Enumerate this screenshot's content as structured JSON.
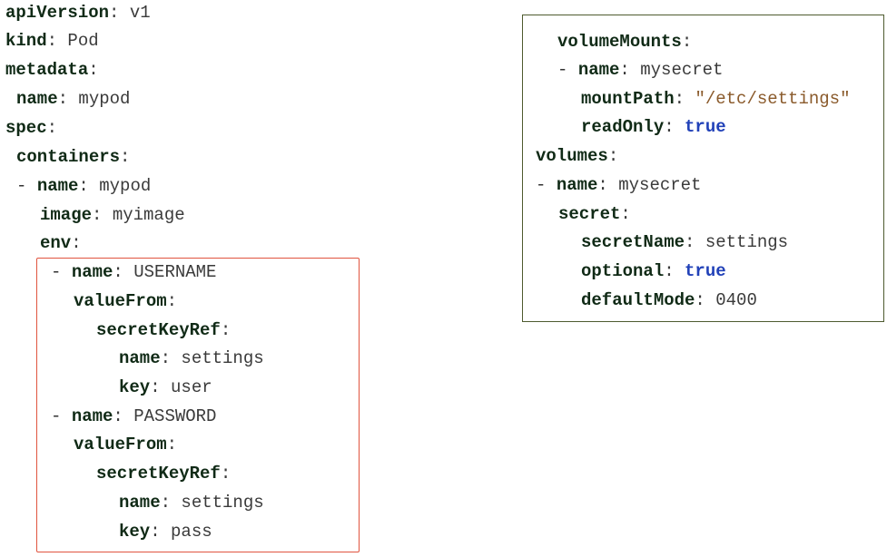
{
  "left": {
    "apiVersion": {
      "key": "apiVersion",
      "value": "v1"
    },
    "kind": {
      "key": "kind",
      "value": "Pod"
    },
    "metadata": {
      "key": "metadata"
    },
    "metadata_name": {
      "key": "name",
      "value": "mypod"
    },
    "spec": {
      "key": "spec"
    },
    "containers": {
      "key": "containers"
    },
    "container_name": {
      "key": "name",
      "value": "mypod"
    },
    "image": {
      "key": "image",
      "value": "myimage"
    },
    "env": {
      "key": "env"
    },
    "env_items": [
      {
        "name_key": "name",
        "name_value": "USERNAME",
        "valueFrom": "valueFrom",
        "secretKeyRef": "secretKeyRef",
        "ref_name_key": "name",
        "ref_name_value": "settings",
        "ref_key_key": "key",
        "ref_key_value": "user"
      },
      {
        "name_key": "name",
        "name_value": "PASSWORD",
        "valueFrom": "valueFrom",
        "secretKeyRef": "secretKeyRef",
        "ref_name_key": "name",
        "ref_name_value": "settings",
        "ref_key_key": "key",
        "ref_key_value": "pass"
      }
    ]
  },
  "right": {
    "volumeMounts": {
      "key": "volumeMounts"
    },
    "mount_name": {
      "key": "name",
      "value": "mysecret"
    },
    "mountPath": {
      "key": "mountPath",
      "value": "\"/etc/settings\""
    },
    "readOnly": {
      "key": "readOnly",
      "value": "true"
    },
    "volumes": {
      "key": "volumes"
    },
    "volume_name": {
      "key": "name",
      "value": "mysecret"
    },
    "secret": {
      "key": "secret"
    },
    "secretName": {
      "key": "secretName",
      "value": "settings"
    },
    "optional": {
      "key": "optional",
      "value": "true"
    },
    "defaultMode": {
      "key": "defaultMode",
      "value": "0400"
    }
  },
  "punct": {
    "colon": ":",
    "dash": "-"
  },
  "colors": {
    "key_text": "#102a16",
    "string_text": "#8a5a2b",
    "boolean_text": "#2141b8",
    "red_box_border": "#e0543f",
    "green_box_border": "#4e5b2f"
  }
}
